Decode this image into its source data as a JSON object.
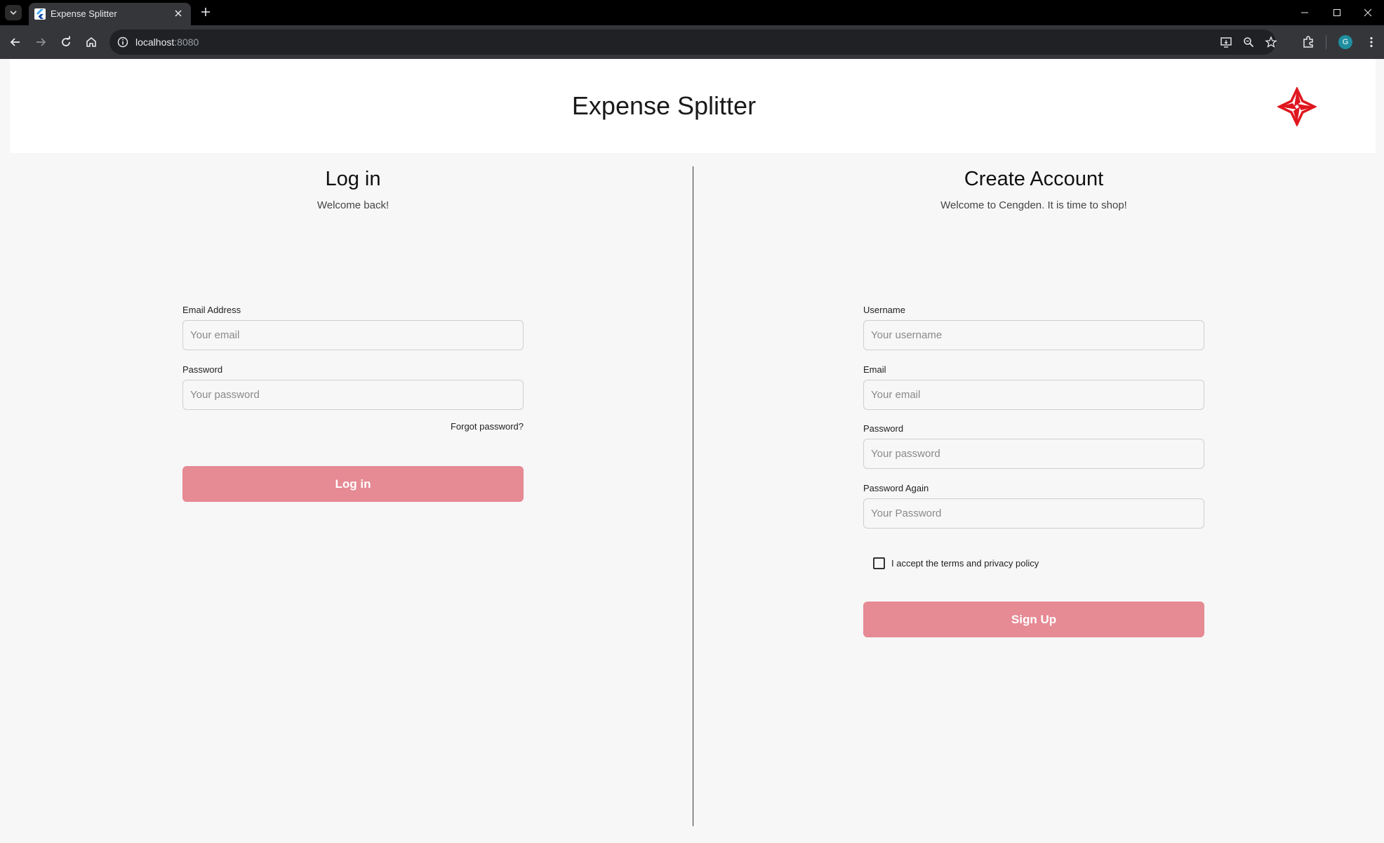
{
  "browser": {
    "tab_title": "Expense Splitter",
    "url_host": "localhost",
    "url_port": ":8080",
    "profile_initial": "G"
  },
  "app": {
    "title": "Expense Splitter"
  },
  "login": {
    "title": "Log in",
    "subtitle": "Welcome back!",
    "email_label": "Email Address",
    "email_placeholder": "Your email",
    "password_label": "Password",
    "password_placeholder": "Your password",
    "forgot_password": "Forgot password?",
    "submit_label": "Log in"
  },
  "signup": {
    "title": "Create Account",
    "subtitle": "Welcome to Cengden. It is time to shop!",
    "username_label": "Username",
    "username_placeholder": "Your username",
    "email_label": "Email",
    "email_placeholder": "Your email",
    "password_label": "Password",
    "password_placeholder": "Your password",
    "password_again_label": "Password Again",
    "password_again_placeholder": "Your Password",
    "terms_label": "I accept the terms and privacy policy",
    "terms_checked": false,
    "submit_label": "Sign Up"
  },
  "colors": {
    "button": "#e68a94",
    "logo": "#e0161e"
  }
}
